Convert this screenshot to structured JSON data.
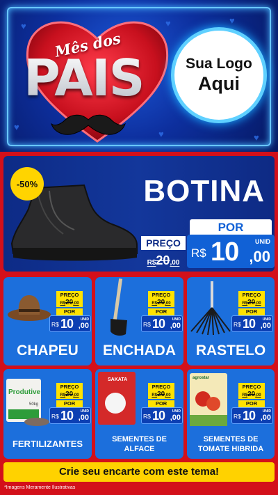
{
  "header": {
    "mes_text": "Mês dos",
    "pais_text": "PAIS",
    "logo_line1": "Sua Logo",
    "logo_line2": "Aqui"
  },
  "hero": {
    "discount_badge": "-50%",
    "title": "BOTINA",
    "preco_label": "PREÇO",
    "old_currency": "R$",
    "old_price": "20",
    "old_cents": ",00",
    "por_label": "POR",
    "new_currency": "R$",
    "new_int": "10",
    "new_dec": ",00",
    "unid": "UNID"
  },
  "products": [
    {
      "name": "CHAPEU",
      "preco_label": "PREÇO",
      "old_currency": "R$",
      "old_price": "20",
      "old_cents": ",00",
      "por_label": "POR",
      "new_currency": "R$",
      "new_int": "10",
      "new_dec": ",00",
      "unid": "UNID"
    },
    {
      "name": "ENCHADA",
      "preco_label": "PREÇO",
      "old_currency": "R$",
      "old_price": "20",
      "old_cents": ",00",
      "por_label": "POR",
      "new_currency": "R$",
      "new_int": "10",
      "new_dec": ",00",
      "unid": "UNID"
    },
    {
      "name": "RASTELO",
      "preco_label": "PREÇO",
      "old_currency": "R$",
      "old_price": "20",
      "old_cents": ",00",
      "por_label": "POR",
      "new_currency": "R$",
      "new_int": "10",
      "new_dec": ",00",
      "unid": "UNID"
    },
    {
      "name": "FERTILIZANTES",
      "preco_label": "PREÇO",
      "old_currency": "R$",
      "old_price": "20",
      "old_cents": ",00",
      "por_label": "POR",
      "new_currency": "R$",
      "new_int": "10",
      "new_dec": ",00",
      "unid": "UNID",
      "package_brand": "Produtive",
      "package_weight": "50kg"
    },
    {
      "name_line1": "SEMENTES DE",
      "name_line2": "ALFACE",
      "preco_label": "PREÇO",
      "old_currency": "R$",
      "old_price": "20",
      "old_cents": ",00",
      "por_label": "POR",
      "new_currency": "R$",
      "new_int": "10",
      "new_dec": ",00",
      "unid": "UNID",
      "package_brand": "SAKATA"
    },
    {
      "name_line1": "SEMENTES DE",
      "name_line2": "TOMATE HIBRIDA",
      "preco_label": "PREÇO",
      "old_currency": "R$",
      "old_price": "20",
      "old_cents": ",00",
      "por_label": "POR",
      "new_currency": "R$",
      "new_int": "10",
      "new_dec": ",00",
      "unid": "UNID",
      "package_brand": "agrostar"
    }
  ],
  "cta_text": "Crie seu encarte com este tema!",
  "disclaimer": "*Imagens Meramente Ilustrativas",
  "colors": {
    "red_bg": "#d3101a",
    "card_blue": "#1c6fdc",
    "hero_navy": "#0d2b86",
    "yellow": "#ffd200"
  }
}
